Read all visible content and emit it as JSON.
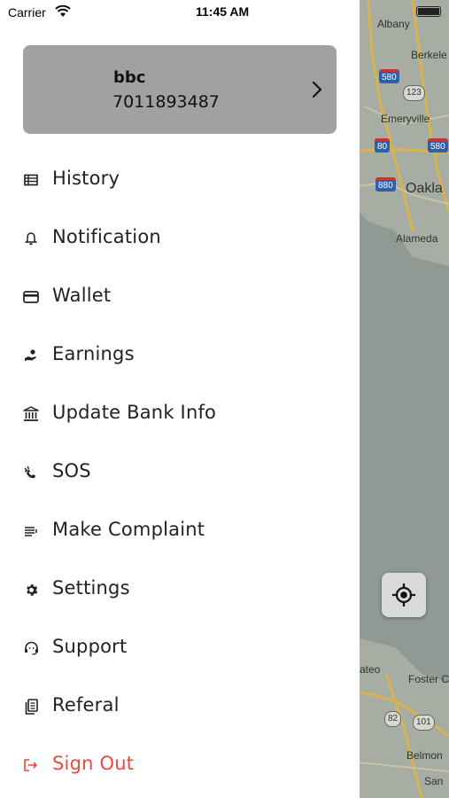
{
  "status_bar": {
    "carrier": "Carrier",
    "time": "11:45 AM"
  },
  "profile": {
    "name": "bbc",
    "phone": "7011893487"
  },
  "menu": [
    {
      "label": "History",
      "icon": "history-list-icon"
    },
    {
      "label": "Notification",
      "icon": "bell-icon"
    },
    {
      "label": "Wallet",
      "icon": "credit-card-icon"
    },
    {
      "label": "Earnings",
      "icon": "earnings-hand-icon"
    },
    {
      "label": "Update Bank Info",
      "icon": "bank-icon"
    },
    {
      "label": "SOS",
      "icon": "sos-call-icon"
    },
    {
      "label": "Make Complaint",
      "icon": "complaint-lines-icon"
    },
    {
      "label": "Settings",
      "icon": "gear-icon"
    },
    {
      "label": "Support",
      "icon": "headset-icon"
    },
    {
      "label": "Referal",
      "icon": "referral-copy-icon"
    },
    {
      "label": "Sign Out",
      "icon": "sign-out-icon"
    }
  ],
  "map": {
    "labels": [
      "Albany",
      "Berkele",
      "Emeryville",
      "Oakla",
      "Alameda",
      "ateo",
      "Foster C",
      "Belmon",
      "San"
    ],
    "shields": [
      "580",
      "123",
      "80",
      "580",
      "880",
      "82",
      "101"
    ]
  },
  "colors": {
    "accent_signout": "#e94b3c",
    "profile_card": "#a1a1a1",
    "map_water": "#8f9a94"
  }
}
